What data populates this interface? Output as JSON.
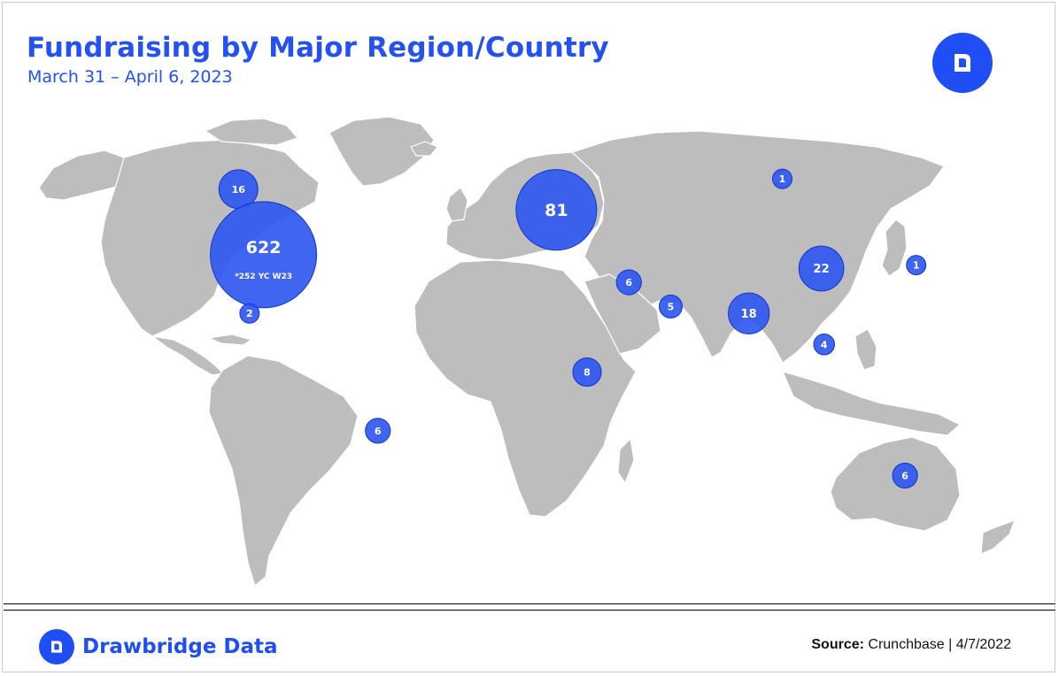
{
  "header": {
    "title": "Fundraising by Major Region/Country",
    "subtitle": "March 31 – April 6, 2023"
  },
  "colors": {
    "accent": "#1f4ef5",
    "bubble_fill": "#2f58f0",
    "land": "#bdbdbd",
    "title": "#2451f0"
  },
  "icons": {
    "header_logo": "drawbridge-logo-icon",
    "footer_logo": "drawbridge-logo-icon"
  },
  "map": {
    "regions": [
      {
        "id": "canada",
        "value": 16,
        "lon": -105,
        "lat": 58
      },
      {
        "id": "united-states",
        "value": 622,
        "note": "*252 YC W23",
        "lon": -96,
        "lat": 39
      },
      {
        "id": "mexico",
        "value": 2,
        "lon": -101,
        "lat": 22
      },
      {
        "id": "south-america",
        "value": 6,
        "lon": -55,
        "lat": -12
      },
      {
        "id": "europe",
        "value": 81,
        "lon": 9,
        "lat": 52
      },
      {
        "id": "africa",
        "value": 8,
        "lon": 20,
        "lat": 5
      },
      {
        "id": "middle-east",
        "value": 6,
        "lon": 35,
        "lat": 31
      },
      {
        "id": "gulf",
        "value": 5,
        "lon": 50,
        "lat": 24
      },
      {
        "id": "india",
        "value": 18,
        "lon": 78,
        "lat": 22
      },
      {
        "id": "russia",
        "value": 1,
        "lon": 90,
        "lat": 61
      },
      {
        "id": "china",
        "value": 22,
        "lon": 104,
        "lat": 35
      },
      {
        "id": "southeast-asia",
        "value": 4,
        "lon": 105,
        "lat": 13
      },
      {
        "id": "japan",
        "value": 1,
        "lon": 138,
        "lat": 36
      },
      {
        "id": "australia",
        "value": 6,
        "lon": 134,
        "lat": -25
      }
    ]
  },
  "footer": {
    "brand": "Drawbridge Data",
    "source_label": "Source:",
    "source_text": " Crunchbase | 4/7/2022"
  }
}
